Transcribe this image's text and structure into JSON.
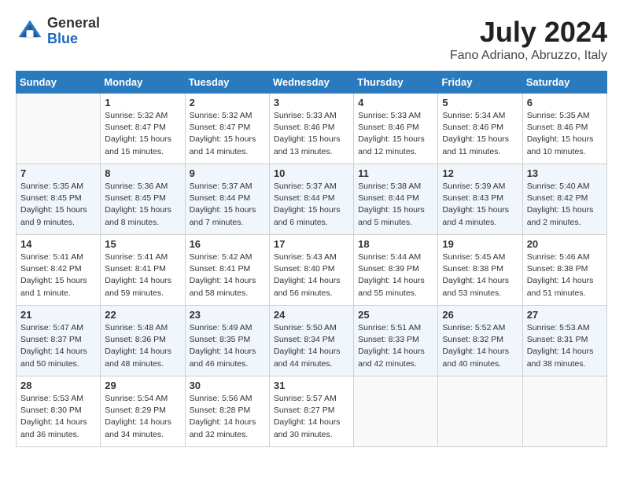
{
  "header": {
    "logo_general": "General",
    "logo_blue": "Blue",
    "month_year": "July 2024",
    "location": "Fano Adriano, Abruzzo, Italy"
  },
  "days_of_week": [
    "Sunday",
    "Monday",
    "Tuesday",
    "Wednesday",
    "Thursday",
    "Friday",
    "Saturday"
  ],
  "weeks": [
    [
      {
        "day": "",
        "empty": true
      },
      {
        "day": "1",
        "sunrise": "Sunrise: 5:32 AM",
        "sunset": "Sunset: 8:47 PM",
        "daylight": "Daylight: 15 hours and 15 minutes."
      },
      {
        "day": "2",
        "sunrise": "Sunrise: 5:32 AM",
        "sunset": "Sunset: 8:47 PM",
        "daylight": "Daylight: 15 hours and 14 minutes."
      },
      {
        "day": "3",
        "sunrise": "Sunrise: 5:33 AM",
        "sunset": "Sunset: 8:46 PM",
        "daylight": "Daylight: 15 hours and 13 minutes."
      },
      {
        "day": "4",
        "sunrise": "Sunrise: 5:33 AM",
        "sunset": "Sunset: 8:46 PM",
        "daylight": "Daylight: 15 hours and 12 minutes."
      },
      {
        "day": "5",
        "sunrise": "Sunrise: 5:34 AM",
        "sunset": "Sunset: 8:46 PM",
        "daylight": "Daylight: 15 hours and 11 minutes."
      },
      {
        "day": "6",
        "sunrise": "Sunrise: 5:35 AM",
        "sunset": "Sunset: 8:46 PM",
        "daylight": "Daylight: 15 hours and 10 minutes."
      }
    ],
    [
      {
        "day": "7",
        "sunrise": "Sunrise: 5:35 AM",
        "sunset": "Sunset: 8:45 PM",
        "daylight": "Daylight: 15 hours and 9 minutes."
      },
      {
        "day": "8",
        "sunrise": "Sunrise: 5:36 AM",
        "sunset": "Sunset: 8:45 PM",
        "daylight": "Daylight: 15 hours and 8 minutes."
      },
      {
        "day": "9",
        "sunrise": "Sunrise: 5:37 AM",
        "sunset": "Sunset: 8:44 PM",
        "daylight": "Daylight: 15 hours and 7 minutes."
      },
      {
        "day": "10",
        "sunrise": "Sunrise: 5:37 AM",
        "sunset": "Sunset: 8:44 PM",
        "daylight": "Daylight: 15 hours and 6 minutes."
      },
      {
        "day": "11",
        "sunrise": "Sunrise: 5:38 AM",
        "sunset": "Sunset: 8:44 PM",
        "daylight": "Daylight: 15 hours and 5 minutes."
      },
      {
        "day": "12",
        "sunrise": "Sunrise: 5:39 AM",
        "sunset": "Sunset: 8:43 PM",
        "daylight": "Daylight: 15 hours and 4 minutes."
      },
      {
        "day": "13",
        "sunrise": "Sunrise: 5:40 AM",
        "sunset": "Sunset: 8:42 PM",
        "daylight": "Daylight: 15 hours and 2 minutes."
      }
    ],
    [
      {
        "day": "14",
        "sunrise": "Sunrise: 5:41 AM",
        "sunset": "Sunset: 8:42 PM",
        "daylight": "Daylight: 15 hours and 1 minute."
      },
      {
        "day": "15",
        "sunrise": "Sunrise: 5:41 AM",
        "sunset": "Sunset: 8:41 PM",
        "daylight": "Daylight: 14 hours and 59 minutes."
      },
      {
        "day": "16",
        "sunrise": "Sunrise: 5:42 AM",
        "sunset": "Sunset: 8:41 PM",
        "daylight": "Daylight: 14 hours and 58 minutes."
      },
      {
        "day": "17",
        "sunrise": "Sunrise: 5:43 AM",
        "sunset": "Sunset: 8:40 PM",
        "daylight": "Daylight: 14 hours and 56 minutes."
      },
      {
        "day": "18",
        "sunrise": "Sunrise: 5:44 AM",
        "sunset": "Sunset: 8:39 PM",
        "daylight": "Daylight: 14 hours and 55 minutes."
      },
      {
        "day": "19",
        "sunrise": "Sunrise: 5:45 AM",
        "sunset": "Sunset: 8:38 PM",
        "daylight": "Daylight: 14 hours and 53 minutes."
      },
      {
        "day": "20",
        "sunrise": "Sunrise: 5:46 AM",
        "sunset": "Sunset: 8:38 PM",
        "daylight": "Daylight: 14 hours and 51 minutes."
      }
    ],
    [
      {
        "day": "21",
        "sunrise": "Sunrise: 5:47 AM",
        "sunset": "Sunset: 8:37 PM",
        "daylight": "Daylight: 14 hours and 50 minutes."
      },
      {
        "day": "22",
        "sunrise": "Sunrise: 5:48 AM",
        "sunset": "Sunset: 8:36 PM",
        "daylight": "Daylight: 14 hours and 48 minutes."
      },
      {
        "day": "23",
        "sunrise": "Sunrise: 5:49 AM",
        "sunset": "Sunset: 8:35 PM",
        "daylight": "Daylight: 14 hours and 46 minutes."
      },
      {
        "day": "24",
        "sunrise": "Sunrise: 5:50 AM",
        "sunset": "Sunset: 8:34 PM",
        "daylight": "Daylight: 14 hours and 44 minutes."
      },
      {
        "day": "25",
        "sunrise": "Sunrise: 5:51 AM",
        "sunset": "Sunset: 8:33 PM",
        "daylight": "Daylight: 14 hours and 42 minutes."
      },
      {
        "day": "26",
        "sunrise": "Sunrise: 5:52 AM",
        "sunset": "Sunset: 8:32 PM",
        "daylight": "Daylight: 14 hours and 40 minutes."
      },
      {
        "day": "27",
        "sunrise": "Sunrise: 5:53 AM",
        "sunset": "Sunset: 8:31 PM",
        "daylight": "Daylight: 14 hours and 38 minutes."
      }
    ],
    [
      {
        "day": "28",
        "sunrise": "Sunrise: 5:53 AM",
        "sunset": "Sunset: 8:30 PM",
        "daylight": "Daylight: 14 hours and 36 minutes."
      },
      {
        "day": "29",
        "sunrise": "Sunrise: 5:54 AM",
        "sunset": "Sunset: 8:29 PM",
        "daylight": "Daylight: 14 hours and 34 minutes."
      },
      {
        "day": "30",
        "sunrise": "Sunrise: 5:56 AM",
        "sunset": "Sunset: 8:28 PM",
        "daylight": "Daylight: 14 hours and 32 minutes."
      },
      {
        "day": "31",
        "sunrise": "Sunrise: 5:57 AM",
        "sunset": "Sunset: 8:27 PM",
        "daylight": "Daylight: 14 hours and 30 minutes."
      },
      {
        "day": "",
        "empty": true
      },
      {
        "day": "",
        "empty": true
      },
      {
        "day": "",
        "empty": true
      }
    ]
  ]
}
